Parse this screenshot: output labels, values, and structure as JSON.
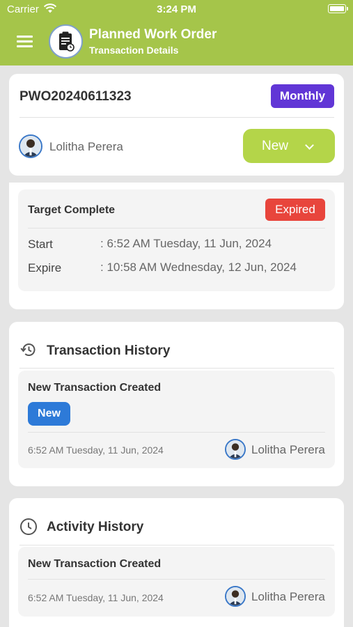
{
  "status_bar": {
    "carrier": "Carrier",
    "time": "3:24 PM"
  },
  "header": {
    "title": "Planned Work Order",
    "subtitle": "Transaction Details"
  },
  "work_order": {
    "id": "PWO20240611323",
    "frequency": "Monthly",
    "assignee": "Lolitha Perera",
    "status": "New"
  },
  "target": {
    "title": "Target Complete",
    "badge": "Expired",
    "start_label": "Start",
    "start_value": ": 6:52 AM Tuesday, 11 Jun, 2024",
    "expire_label": "Expire",
    "expire_value": ": 10:58 AM Wednesday, 12 Jun, 2024"
  },
  "transaction_history": {
    "title": "Transaction History",
    "icon": "history-icon",
    "items": [
      {
        "title": "New Transaction Created",
        "badge": "New",
        "timestamp": "6:52 AM Tuesday, 11 Jun, 2024",
        "user": "Lolitha Perera"
      }
    ]
  },
  "activity_history": {
    "title": "Activity History",
    "icon": "clock-icon",
    "items": [
      {
        "title": "New Transaction Created",
        "timestamp": "6:52 AM Tuesday, 11 Jun, 2024",
        "user": "Lolitha Perera"
      }
    ]
  },
  "colors": {
    "header": "#a5c54a",
    "monthly_badge": "#6136d6",
    "expired_badge": "#e8453c",
    "new_badge": "#2d7ad8",
    "status_dropdown": "#b4d549"
  }
}
